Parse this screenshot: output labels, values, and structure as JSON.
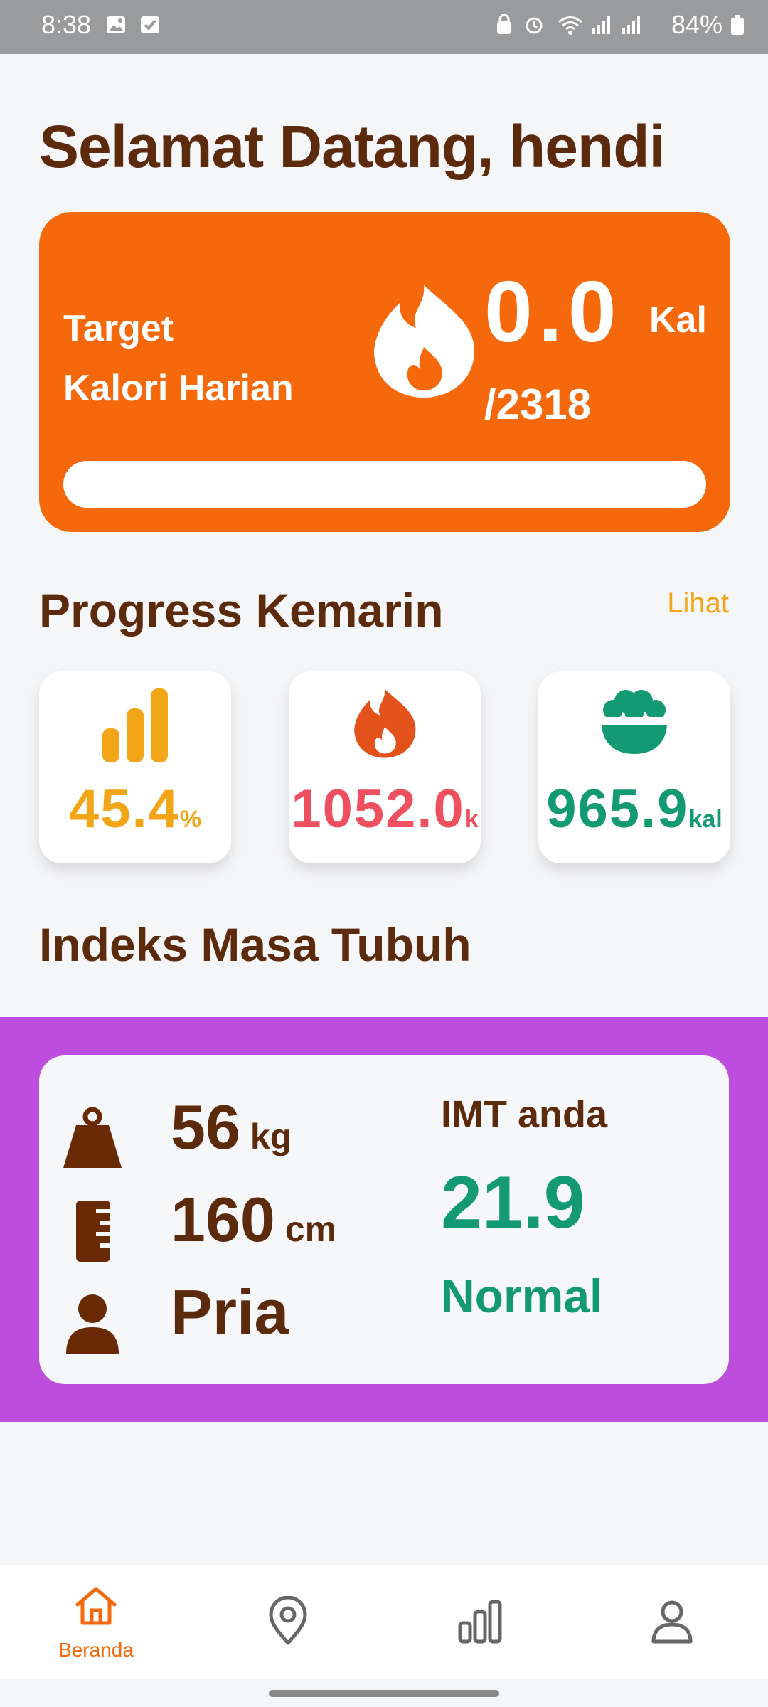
{
  "status_bar": {
    "time": "8:38",
    "battery": "84%"
  },
  "header": {
    "title": "Selamat Datang, hendi"
  },
  "calorie_card": {
    "label_line1": "Target",
    "label_line2": "Kalori Harian",
    "value": "0.0",
    "unit": "Kal",
    "target": "/2318",
    "progress_fraction": 0.0,
    "color": "#f5680c"
  },
  "progress_section": {
    "title": "Progress Kemarin",
    "link": "Lihat",
    "cards": [
      {
        "icon": "bar-chart-icon",
        "value": "45.4",
        "unit": "%",
        "color": "#f2a516"
      },
      {
        "icon": "fire-icon",
        "value": "1052.0",
        "unit": "k",
        "color": "#ee5060"
      },
      {
        "icon": "food-bowl-icon",
        "value": "965.9",
        "unit": "kal",
        "color": "#139a73"
      }
    ]
  },
  "imt_section": {
    "title": "Indeks Masa Tubuh",
    "weight": {
      "value": "56",
      "unit": "kg",
      "icon": "weight-icon"
    },
    "height": {
      "value": "160",
      "unit": "cm",
      "icon": "ruler-icon"
    },
    "gender": {
      "value": "Pria",
      "icon": "person-icon"
    },
    "imt_label": "IMT anda",
    "imt_value": "21.9",
    "imt_status": "Normal",
    "band_color": "#bd4ddd"
  },
  "bottom_nav": {
    "items": [
      {
        "icon": "home-icon",
        "label": "Beranda",
        "active": true
      },
      {
        "icon": "location-icon",
        "label": "",
        "active": false
      },
      {
        "icon": "bar-chart-icon",
        "label": "",
        "active": false
      },
      {
        "icon": "profile-icon",
        "label": "",
        "active": false
      }
    ]
  }
}
